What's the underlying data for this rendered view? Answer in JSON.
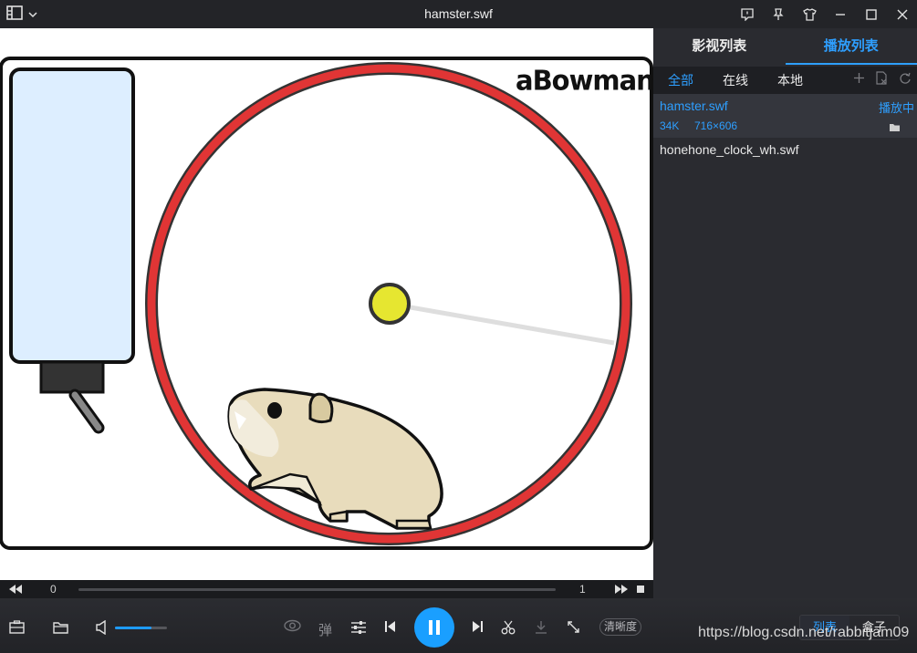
{
  "window": {
    "title": "hamster.swf"
  },
  "player": {
    "watermark": "aBowman"
  },
  "progress": {
    "current": "0",
    "total": "1"
  },
  "controls": {
    "danmaku_label": "弹",
    "clarity_label": "清晰度",
    "volume_level": 0.7,
    "view_toggle": {
      "list": "列表",
      "box": "盒子"
    }
  },
  "sidebar": {
    "tabs": [
      {
        "label": "影视列表"
      },
      {
        "label": "播放列表"
      }
    ],
    "subtabs": [
      {
        "label": "全部"
      },
      {
        "label": "在线"
      },
      {
        "label": "本地"
      }
    ],
    "items": [
      {
        "name": "hamster.swf",
        "status": "播放中",
        "size": "34K",
        "resolution": "716×606"
      },
      {
        "name": "honehone_clock_wh.swf"
      }
    ]
  },
  "watermark_text": "https://blog.csdn.net/rabbitjam09",
  "colors": {
    "accent": "#2e9fff",
    "wheel": "#e03535",
    "hamster": "#e8dcbc",
    "bottle": "#ddeeff",
    "ball": "#e6e630"
  }
}
